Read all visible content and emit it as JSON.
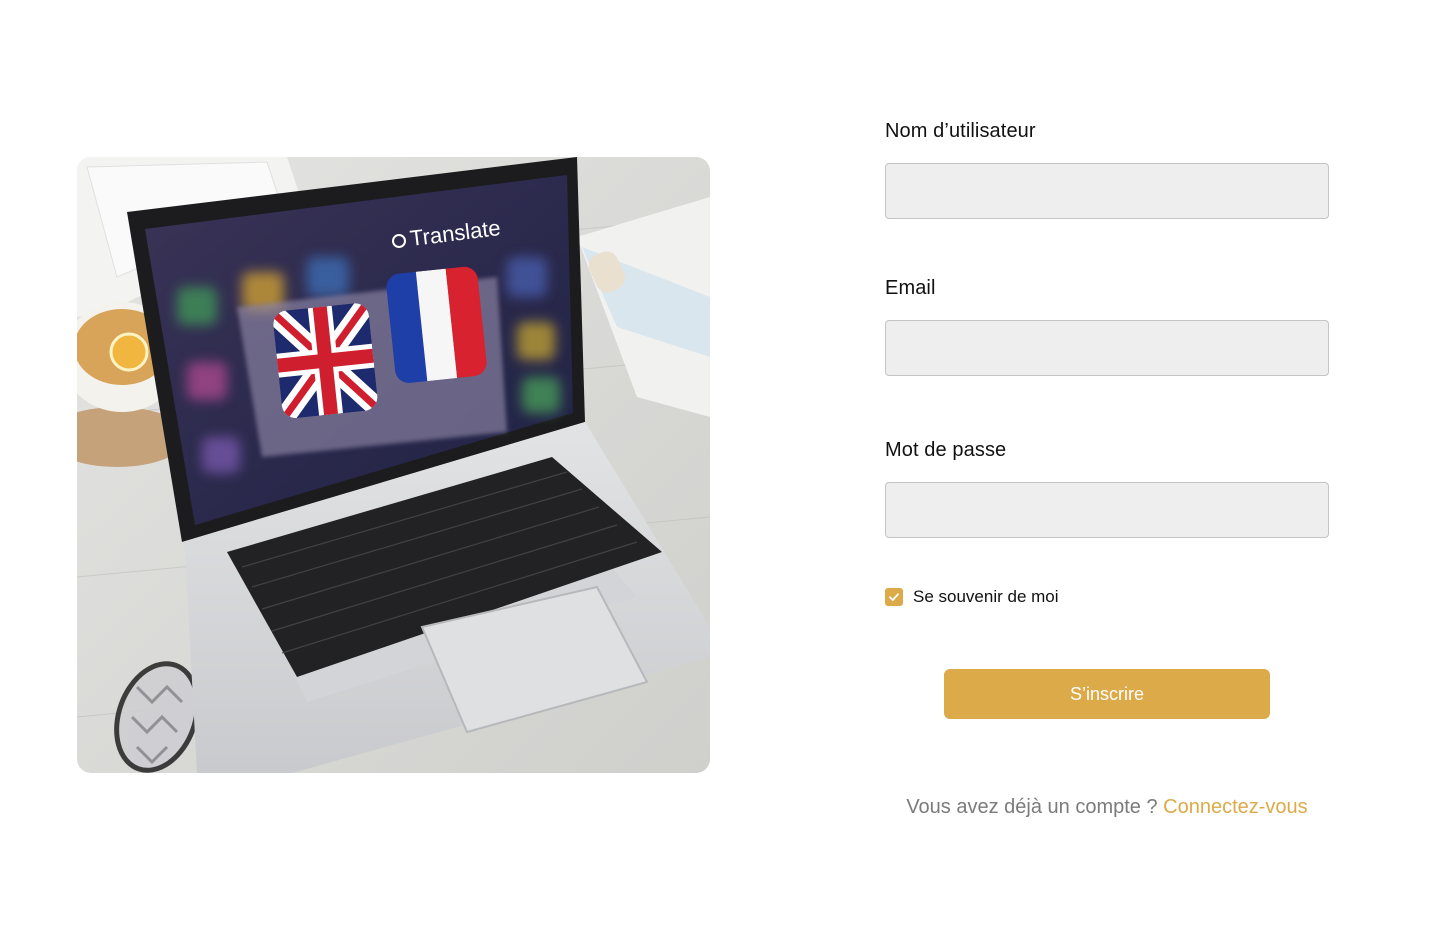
{
  "hero": {
    "image_label": "Translate",
    "icons": [
      "uk-flag-icon",
      "france-flag-icon",
      "translate-icon"
    ]
  },
  "form": {
    "username": {
      "label": "Nom d’utilisateur",
      "value": "",
      "placeholder": ""
    },
    "email": {
      "label": "Email",
      "value": "",
      "placeholder": ""
    },
    "password": {
      "label": "Mot de passe",
      "value": "",
      "placeholder": ""
    },
    "remember_me": {
      "label": "Se souvenir de moi",
      "checked": true
    },
    "submit_label": "S’inscrire",
    "signin_prompt": "Vous avez déjà un compte ?",
    "signin_link": "Connectez-vous"
  },
  "colors": {
    "accent": "#dcaa48",
    "input_bg": "#eeeeee",
    "input_border": "#c4c4c4",
    "muted_text": "#7b7b7b"
  }
}
